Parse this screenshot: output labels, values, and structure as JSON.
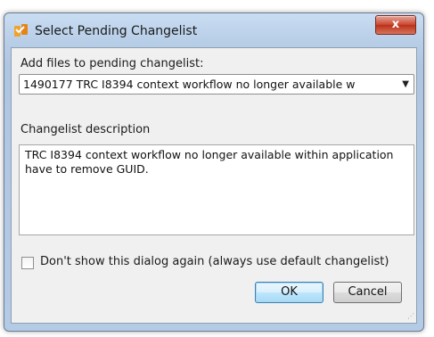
{
  "dialog": {
    "title": "Select Pending Changelist",
    "close_label": "x"
  },
  "changelist": {
    "label": "Add files to pending changelist:",
    "selected": "1490177  TRC I8394 context workflow no longer available w"
  },
  "description": {
    "label": "Changelist description",
    "text": "TRC I8394 context workflow no longer available within application have to remove GUID."
  },
  "options": {
    "dont_show_label": "Don't show this dialog again (always use default changelist)",
    "dont_show_checked": false
  },
  "buttons": {
    "ok": "OK",
    "cancel": "Cancel"
  },
  "icons": {
    "app": "p4-changelist-icon",
    "close": "close-icon",
    "dropdown": "chevron-down-icon"
  },
  "colors": {
    "title_bar": "#b9cfe8",
    "close_button": "#c9442e",
    "ok_border": "#3c7fb1"
  }
}
